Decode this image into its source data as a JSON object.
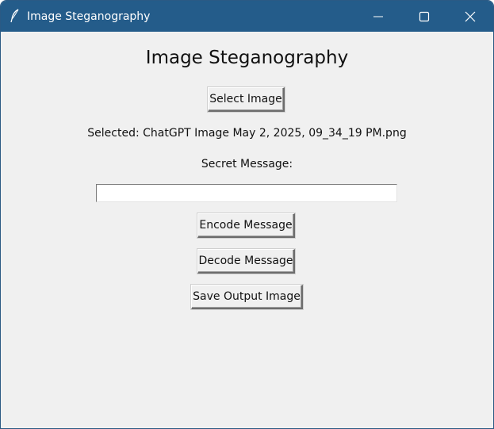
{
  "window": {
    "title": "Image Steganography",
    "icon": "feather-icon",
    "titlebar_color": "#245c8a",
    "controls": {
      "minimize": "minimize-icon",
      "maximize": "maximize-icon",
      "close": "close-icon"
    }
  },
  "main": {
    "heading": "Image Steganography",
    "select_button_label": "Select Image",
    "selected_text": "Selected: ChatGPT Image May 2, 2025, 09_34_19 PM.png",
    "secret_label": "Secret Message:",
    "message_input": {
      "value": "",
      "placeholder": ""
    },
    "encode_button_label": "Encode Message",
    "decode_button_label": "Decode Message",
    "save_button_label": "Save Output Image"
  }
}
